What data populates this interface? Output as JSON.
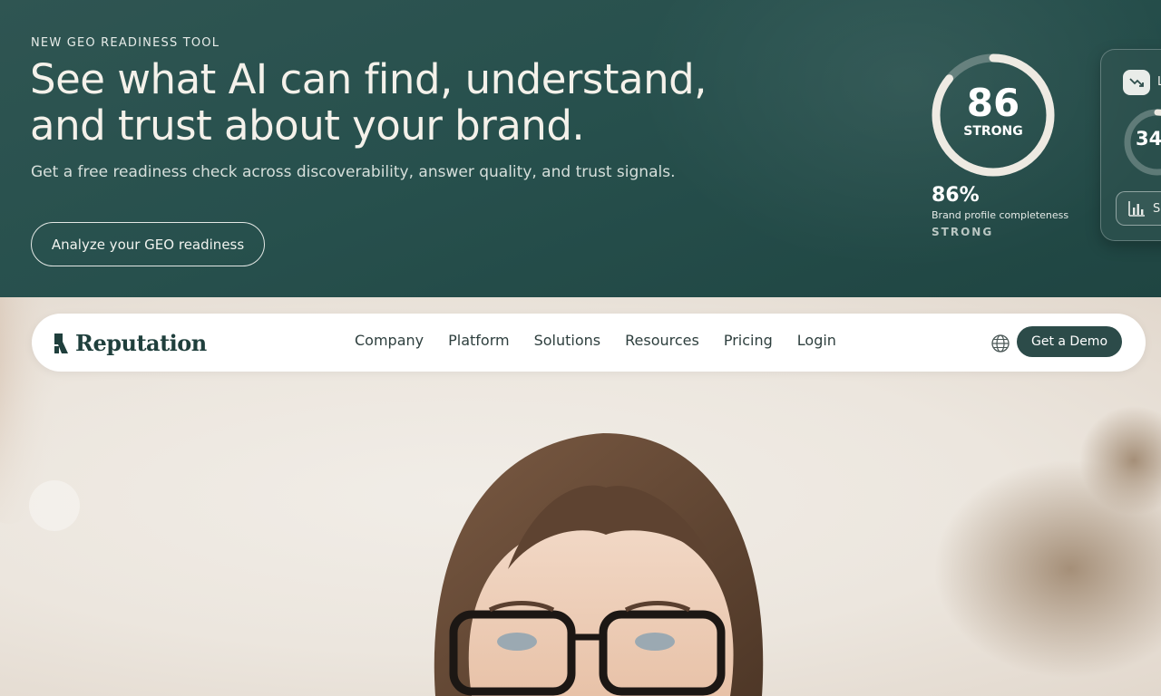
{
  "banner": {
    "eyebrow": "NEW GEO READINESS TOOL",
    "headline_line1": "See what AI can find, understand,",
    "headline_line2": "and trust about your brand.",
    "subhead": "Get a free readiness check across discoverability, answer quality, and trust signals.",
    "cta_label": "Analyze your GEO readiness",
    "score": {
      "value": "86",
      "label": "STRONG",
      "ring_fraction": 0.86
    },
    "profile": {
      "percent": "86%",
      "caption": "Brand profile completeness",
      "status": "STRONG"
    },
    "side_card": {
      "chip_text": "L",
      "value": "34",
      "button_text": "S",
      "ring_fraction": 0.34
    }
  },
  "nav": {
    "brand": "Reputation",
    "links": [
      "Company",
      "Platform",
      "Solutions",
      "Resources",
      "Pricing",
      "Login"
    ],
    "demo_label": "Get a Demo"
  },
  "colors": {
    "banner_bg": "#27504d",
    "primary_button": "#2c4b49",
    "ring_track": "#5e7a77",
    "ring_fill": "#ede9e1"
  },
  "icons": [
    "reputation-logo-icon",
    "globe-icon",
    "trend-down-icon",
    "bar-chart-icon"
  ]
}
